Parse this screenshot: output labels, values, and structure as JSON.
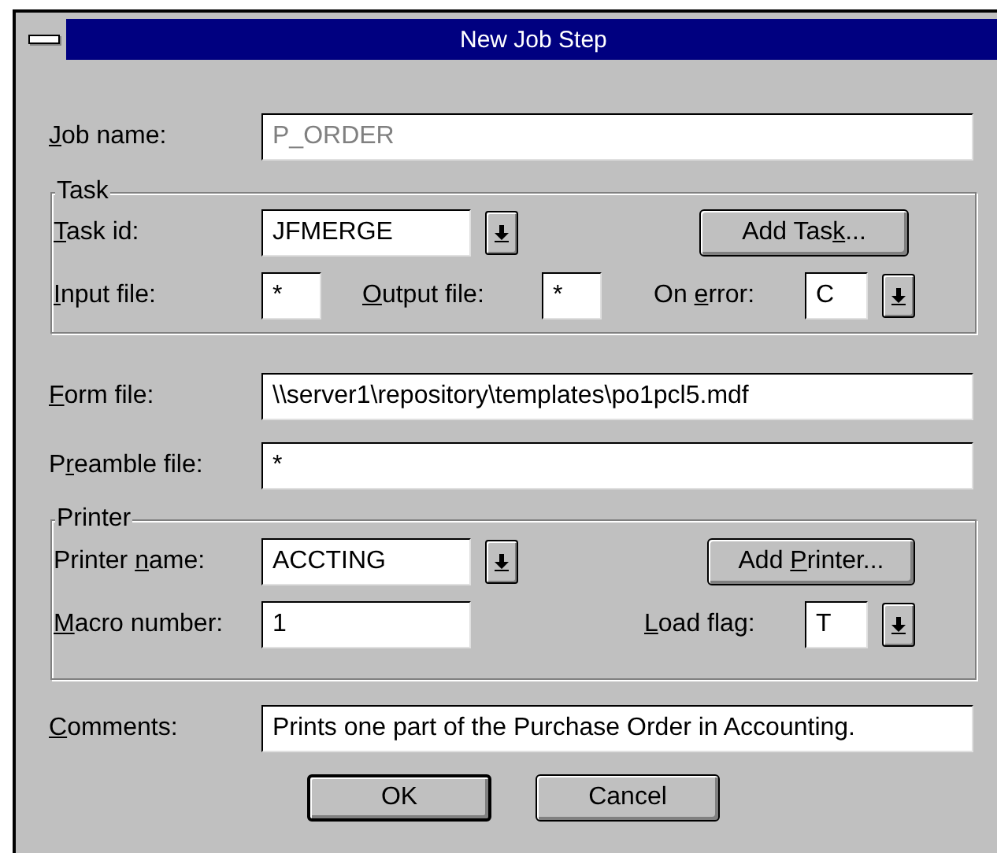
{
  "window": {
    "title": "New Job Step"
  },
  "job_name": {
    "label": {
      "key": "J",
      "post": "ob name:"
    },
    "value": "P_ORDER",
    "disabled": true
  },
  "task": {
    "title": "Task",
    "task_id": {
      "label": {
        "key": "T",
        "post": "ask id:"
      },
      "value": "JFMERGE"
    },
    "add_button": [
      "Add Tas",
      "k",
      "..."
    ],
    "input_file": {
      "label": {
        "key": "I",
        "post": "nput file:"
      },
      "value": "*"
    },
    "output_file": {
      "label": {
        "key": "O",
        "post": "utput file:"
      },
      "value": "*"
    },
    "on_error": {
      "label": {
        "pre": "On ",
        "key": "e",
        "post": "rror:"
      },
      "value": "C"
    }
  },
  "form_file": {
    "label": {
      "key": "F",
      "post": "orm file:"
    },
    "value": "\\\\server1\\repository\\templates\\po1pcl5.mdf"
  },
  "preamble_file": {
    "label": {
      "pre": "P",
      "key": "r",
      "post": "eamble file:"
    },
    "value": "*"
  },
  "printer": {
    "title": "Printer",
    "printer_name": {
      "label": {
        "pre": "Printer ",
        "key": "n",
        "post": "ame:"
      },
      "value": "ACCTING"
    },
    "add_button": [
      "Add ",
      "P",
      "rinter..."
    ],
    "macro_number": {
      "label": {
        "key": "M",
        "post": "acro number:"
      },
      "value": "1"
    },
    "load_flag": {
      "label": {
        "key": "L",
        "post": "oad flag:"
      },
      "value": "T"
    }
  },
  "comments": {
    "label": {
      "key": "C",
      "post": "omments:"
    },
    "value": "Prints one part of the Purchase Order in Accounting."
  },
  "buttons": [
    {
      "label": "OK",
      "default": true
    },
    {
      "label": "Cancel",
      "default": false
    }
  ]
}
